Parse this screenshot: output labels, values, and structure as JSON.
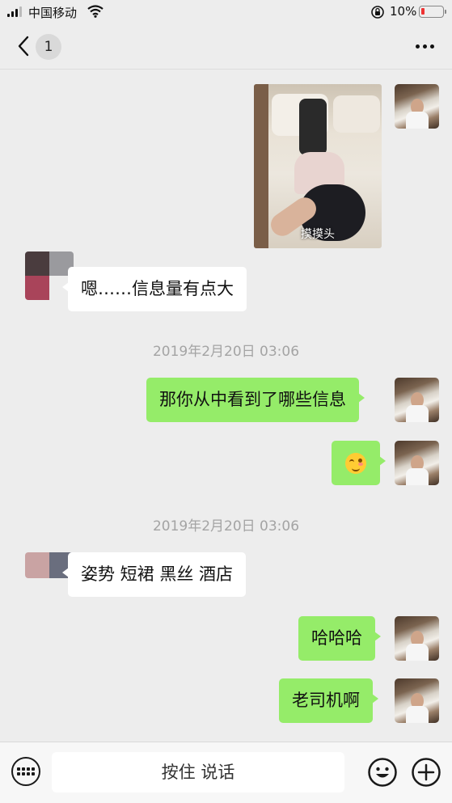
{
  "status_bar": {
    "carrier": "中国移动",
    "battery_percent": "10%",
    "battery_color": "#e33333"
  },
  "nav": {
    "back_badge": "1"
  },
  "messages": [
    {
      "side": "me",
      "type": "image",
      "caption": "摸摸头"
    },
    {
      "side": "other",
      "type": "text",
      "text": "嗯……信息量有点大"
    },
    {
      "type": "timestamp",
      "text": "2019年2月20日 03:06"
    },
    {
      "side": "me",
      "type": "text",
      "text": "那你从中看到了哪些信息"
    },
    {
      "side": "me",
      "type": "emoji",
      "emoji": "smiling-face-icon"
    },
    {
      "type": "timestamp",
      "text": "2019年2月20日 03:06"
    },
    {
      "side": "other",
      "type": "text",
      "text": "姿势 短裙 黑丝 酒店"
    },
    {
      "side": "me",
      "type": "text",
      "text": "哈哈哈"
    },
    {
      "side": "me",
      "type": "text",
      "text": "老司机啊"
    }
  ],
  "input_bar": {
    "hold_to_talk": "按住 说话"
  },
  "colors": {
    "my_bubble": "#95ec69",
    "other_bubble": "#ffffff",
    "background": "#ededed",
    "timestamp": "#a4a4a4"
  }
}
